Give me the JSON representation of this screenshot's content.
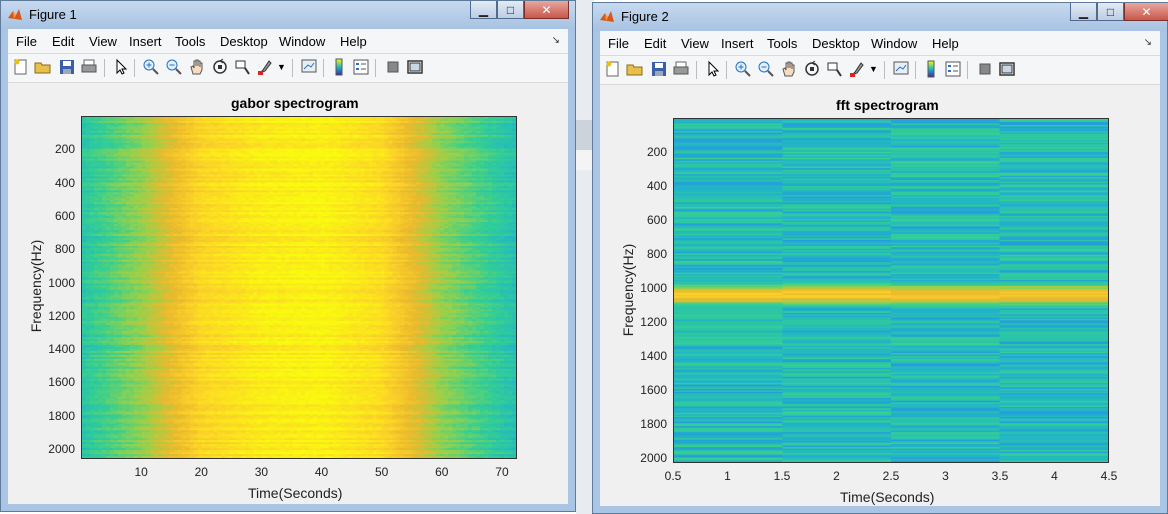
{
  "menu_items": [
    "File",
    "Edit",
    "View",
    "Insert",
    "Tools",
    "Desktop",
    "Window",
    "Help"
  ],
  "figures": [
    {
      "window_title": "Figure 1",
      "chart_data": {
        "type": "heatmap",
        "title": "gabor spectrogram",
        "xlabel": "Time(Seconds)",
        "ylabel": "Frequency(Hz)",
        "xlim": [
          0,
          72.5
        ],
        "ylim": [
          0,
          2060
        ],
        "y_reversed": true,
        "xticks": [
          10,
          20,
          30,
          40,
          50,
          60,
          70
        ],
        "yticks": [
          200,
          400,
          600,
          800,
          1000,
          1200,
          1400,
          1600,
          1800,
          2000
        ],
        "colormap": "parula",
        "intensity_by_time": [
          {
            "t": 0,
            "level": 0.45
          },
          {
            "t": 10,
            "level": 0.62
          },
          {
            "t": 20,
            "level": 0.88
          },
          {
            "t": 30,
            "level": 0.95
          },
          {
            "t": 40,
            "level": 0.97
          },
          {
            "t": 50,
            "level": 0.9
          },
          {
            "t": 60,
            "level": 0.62
          },
          {
            "t": 72.5,
            "level": 0.42
          }
        ],
        "description_peak": "broad high-intensity band between about 18 s and 58 s across all frequencies"
      }
    },
    {
      "window_title": "Figure 2",
      "chart_data": {
        "type": "heatmap",
        "title": "fft spectrogram",
        "xlabel": "Time(Seconds)",
        "ylabel": "Frequency(Hz)",
        "xlim": [
          0.5,
          4.5
        ],
        "ylim": [
          0,
          2030
        ],
        "y_reversed": true,
        "xticks": [
          0.5,
          1,
          1.5,
          2,
          2.5,
          3,
          3.5,
          4,
          4.5
        ],
        "yticks": [
          200,
          400,
          600,
          800,
          1000,
          1200,
          1400,
          1600,
          1800,
          2000
        ],
        "colormap": "parula",
        "time_bins": [
          1,
          2,
          3,
          4
        ],
        "bin_edges": [
          0.5,
          1.5,
          2.5,
          3.5,
          4.5
        ],
        "base_level": 0.4,
        "peak": {
          "frequency_hz": 1040,
          "width_hz": 60,
          "level": 0.82
        }
      }
    }
  ]
}
